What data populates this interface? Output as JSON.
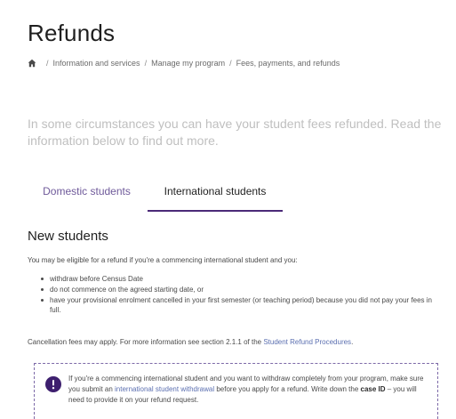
{
  "page": {
    "title": "Refunds"
  },
  "breadcrumb": {
    "home_icon": "home-icon",
    "separator": "/",
    "items": [
      "Information and services",
      "Manage my program",
      "Fees, payments, and refunds"
    ]
  },
  "intro": {
    "text": "In some circumstances you can have your student fees refunded. Read the information below to find out more."
  },
  "tabs": [
    {
      "label": "Domestic students",
      "selected": false
    },
    {
      "label": "International students",
      "selected": true
    }
  ],
  "new_students": {
    "heading": "New students",
    "lead": "You may be eligible for a refund if you're a commencing international student and you:",
    "bullets": [
      "withdraw before Census Date",
      "do not commence on the agreed starting date, or",
      "have your provisional enrolment cancelled in your first semester (or teaching period) because you did not pay your fees in full."
    ],
    "cancellation_prefix": "Cancellation fees may apply. For more information see section 2.1.1 of the ",
    "cancellation_link": "Student Refund Procedures",
    "cancellation_suffix": "."
  },
  "notice": {
    "icon": "exclamation-circle-icon",
    "part1": "If you're a commencing international student and you want to withdraw completely from your program, make sure you submit an ",
    "link": "international student withdrawal",
    "part2": " before you apply for a refund. Write down the ",
    "bold": "case ID",
    "part3": " – you will need to provide it on your refund request."
  },
  "colors": {
    "accent": "#4b2a78",
    "link": "#5b6fb0",
    "intro_text": "#bfbfbf"
  }
}
